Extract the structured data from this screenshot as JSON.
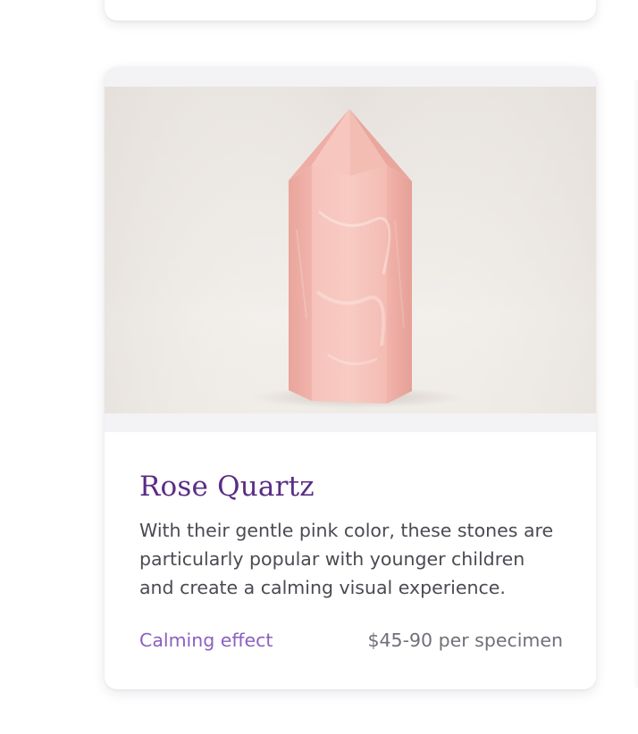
{
  "card": {
    "title": "Rose Quartz",
    "description": "With their gentle pink color, these stones are particularly popular with younger children and create a calming visual experience.",
    "tag": "Calming effect",
    "price": "$45-90 per specimen",
    "image_subject": "rose-quartz-point",
    "colors": {
      "title": "#5a2d84",
      "tag": "#8b60c0",
      "text": "#4a4b52",
      "price": "#6f7078",
      "crystal": "#f2b8b0"
    }
  }
}
